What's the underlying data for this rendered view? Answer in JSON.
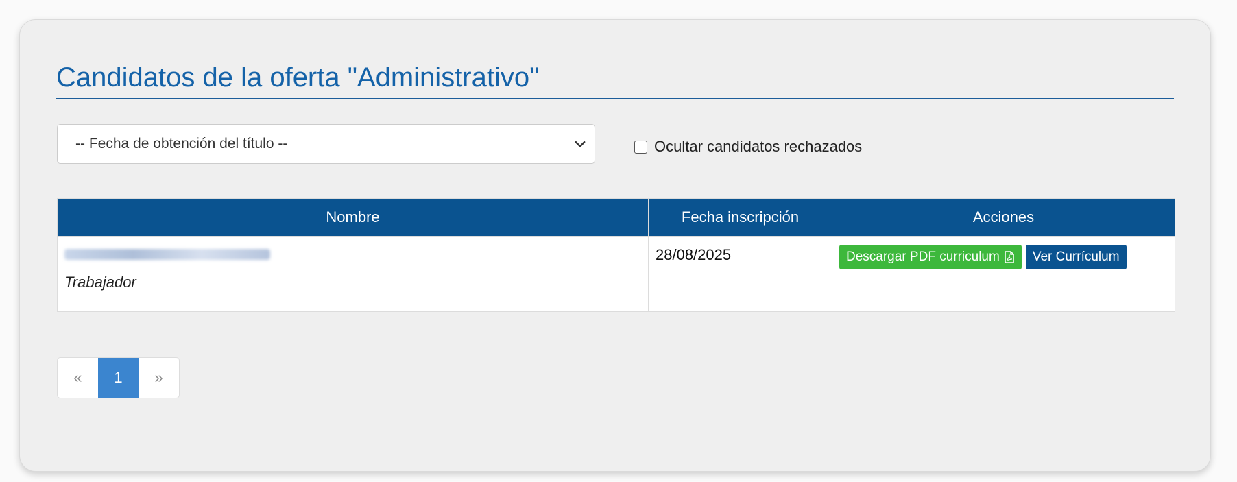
{
  "header": {
    "title": "Candidatos de la oferta \"Administrativo\""
  },
  "filters": {
    "select_value": "-- Fecha de obtención del título --",
    "checkbox_label": "Ocultar candidatos rechazados",
    "checkbox_checked": false
  },
  "table": {
    "columns": [
      "Nombre",
      "Fecha inscripción",
      "Acciones"
    ],
    "rows": [
      {
        "name": "",
        "role": "Trabajador",
        "date": "28/08/2025",
        "download_label": "Descargar PDF curriculum",
        "view_label": "Ver Currículum"
      }
    ]
  },
  "pagination": {
    "prev": "«",
    "current": "1",
    "next": "»"
  },
  "colors": {
    "title": "#1462a8",
    "table_header": "#0a5390",
    "download_button": "#3db83c",
    "view_button": "#0a5390",
    "active_page": "#3b85cf"
  },
  "icons": {
    "select": "chevron-down-icon",
    "download": "pdf-file-icon"
  }
}
